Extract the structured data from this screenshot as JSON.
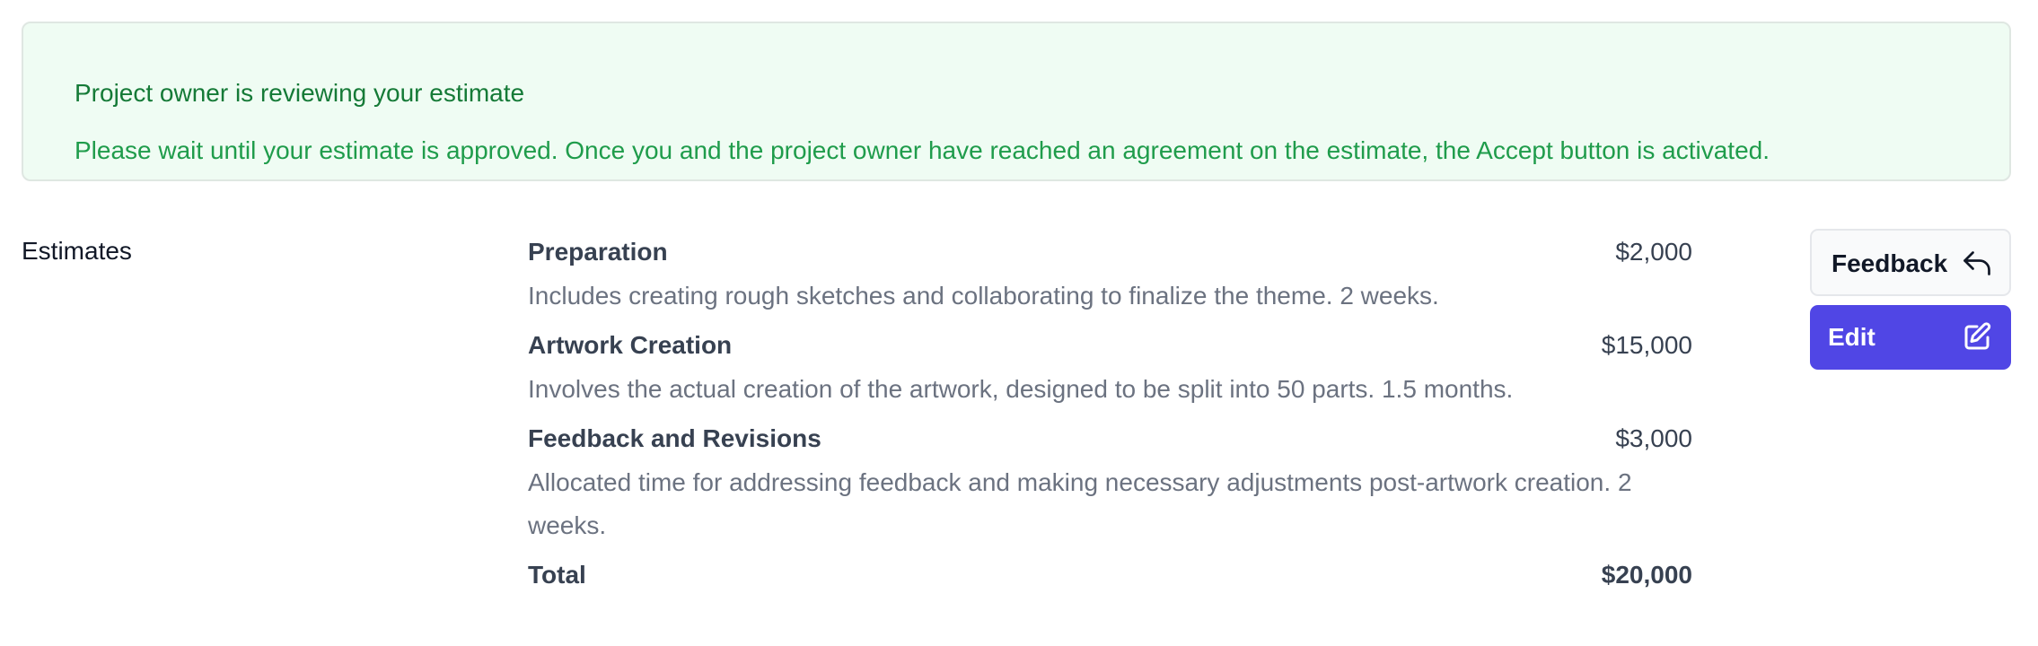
{
  "alert": {
    "title": "Project owner is reviewing your estimate",
    "message": "Please wait until your estimate is approved. Once you and the project owner have reached an agreement on the estimate, the Accept button is activated."
  },
  "section": {
    "label": "Estimates"
  },
  "estimates": {
    "items": [
      {
        "name": "Preparation",
        "amount": "$2,000",
        "description": "Includes creating rough sketches and collaborating to finalize the theme. 2 weeks."
      },
      {
        "name": "Artwork Creation",
        "amount": "$15,000",
        "description": "Involves the actual creation of the artwork, designed to be split into 50 parts. 1.5 months."
      },
      {
        "name": "Feedback and Revisions",
        "amount": "$3,000",
        "description": "Allocated time for addressing feedback and making necessary adjustments post-artwork creation. 2 weeks."
      }
    ],
    "total_label": "Total",
    "total_amount": "$20,000"
  },
  "actions": {
    "feedback_label": "Feedback",
    "feedback_icon": "reply-arrow-icon",
    "edit_label": "Edit",
    "edit_icon": "pencil-square-icon"
  },
  "colors": {
    "alert_background": "#effcf3",
    "alert_title": "#157a37",
    "alert_text": "#1f9c4b",
    "edit_button": "#5046e5"
  }
}
